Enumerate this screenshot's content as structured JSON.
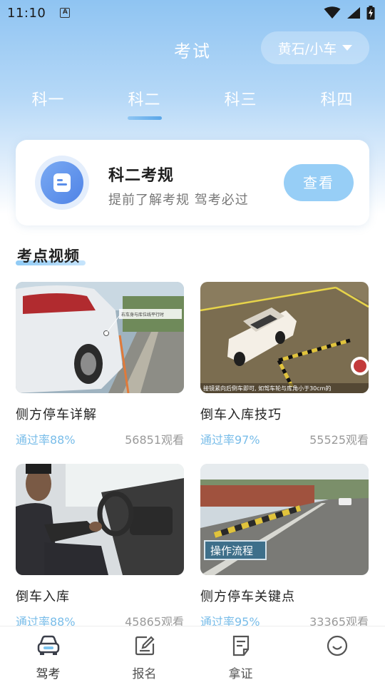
{
  "status_bar": {
    "time": "11:10",
    "notification_badge": "A"
  },
  "header": {
    "title": "考试",
    "city_select": "黄石/小车"
  },
  "tabs": [
    {
      "label": "科一",
      "active": false
    },
    {
      "label": "科二",
      "active": true
    },
    {
      "label": "科三",
      "active": false
    },
    {
      "label": "科四",
      "active": false
    }
  ],
  "rule_card": {
    "title": "科二考规",
    "subtitle": "提前了解考规 驾考必过",
    "button": "查看"
  },
  "videos_section": {
    "title": "考点视频",
    "items": [
      {
        "name": "侧方停车详解",
        "pass_rate": "通过率88%",
        "views": "56851观看",
        "overlay_text": "右车身与库位线平行时"
      },
      {
        "name": "倒车入库技巧",
        "pass_rate": "通过率97%",
        "views": "55525观看",
        "overlay_text": "接镜紧向后倒车即可, 如驾车轮与库角小于30cm的"
      },
      {
        "name": "倒车入库",
        "pass_rate": "通过率88%",
        "views": "45865观看"
      },
      {
        "name": "侧方停车关键点",
        "pass_rate": "通过率95%",
        "views": "33365观看",
        "overlay_text": "操作流程"
      }
    ]
  },
  "bottom_nav": [
    {
      "label": "驾考",
      "icon": "car-icon",
      "active": true
    },
    {
      "label": "报名",
      "icon": "edit-icon",
      "active": false
    },
    {
      "label": "拿证",
      "icon": "document-icon",
      "active": false
    },
    {
      "label": "",
      "icon": "smile-icon",
      "active": false
    }
  ],
  "colors": {
    "accent": "#97cef6",
    "pass_rate": "#79bde9",
    "header_gradient_top": "#8fc4f2"
  }
}
